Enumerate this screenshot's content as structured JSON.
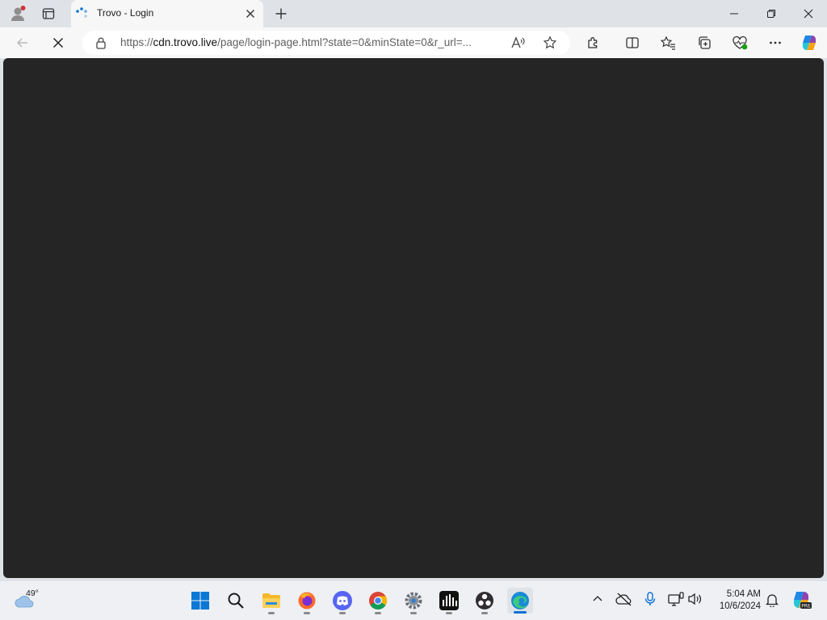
{
  "tab": {
    "title": "Trovo - Login",
    "close_icon": "close-icon",
    "new_tab_icon": "plus-icon"
  },
  "address_bar": {
    "url_prefix": "https://",
    "url_host": "cdn.trovo.live",
    "url_rest": "/page/login-page.html?state=0&minState=0&r_url=..."
  },
  "taskbar": {
    "weather_temp": "49°",
    "time": "5:04 AM",
    "date": "10/6/2024"
  },
  "colors": {
    "page_bg": "#252525",
    "chrome_bg": "#dfe3e8",
    "toolbar_bg": "#f7f7f7",
    "accent": "#0078d4"
  }
}
